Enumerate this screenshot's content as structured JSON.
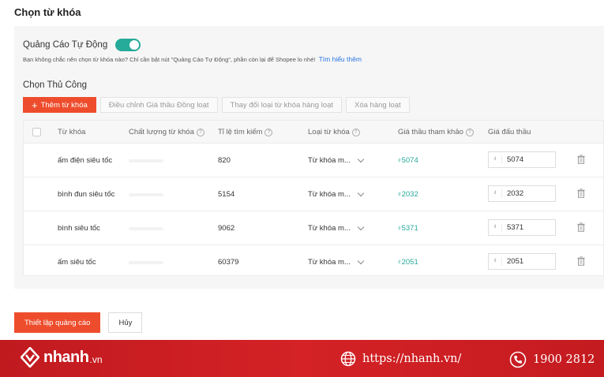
{
  "section_title": "Chọn từ khóa",
  "auto_ads": {
    "label": "Quảng Cáo Tự Động",
    "enabled": true,
    "description": "Bạn không chắc nên chọn từ khóa nào? Chỉ cần bật nút \"Quảng Cáo Tự Động\", phần còn lại để Shopee lo nhé!",
    "learn_more": "Tìm hiểu thêm"
  },
  "manual": {
    "title": "Chọn Thủ Công",
    "add_keyword": "Thêm từ khóa",
    "adjust_bid": "Điều chỉnh Giá thầu Đồng loạt",
    "change_type": "Thay đổi loại từ khóa hàng loạt",
    "delete_bulk": "Xóa hàng loạt"
  },
  "table": {
    "headers": {
      "keyword": "Từ khóa",
      "quality": "Chất lượng từ khóa",
      "search_rate": "Tỉ lệ tìm kiếm",
      "type": "Loại từ khóa",
      "ref_bid": "Giá thầu tham khảo",
      "bid": "Giá đấu thầu"
    },
    "currency": "₫",
    "rows": [
      {
        "keyword": "ấm điện siêu tốc",
        "quality": 0.68,
        "search_rate": "820",
        "type": "Từ khóa m...",
        "ref_bid": "5074",
        "bid": "5074"
      },
      {
        "keyword": "bình đun siêu tốc",
        "quality": 0.78,
        "search_rate": "5154",
        "type": "Từ khóa m...",
        "ref_bid": "2032",
        "bid": "2032"
      },
      {
        "keyword": "bình siêu tốc",
        "quality": 0.68,
        "search_rate": "9062",
        "type": "Từ khóa m...",
        "ref_bid": "5371",
        "bid": "5371"
      },
      {
        "keyword": "ấm siêu tốc",
        "quality": 0.88,
        "search_rate": "60379",
        "type": "Từ khóa m...",
        "ref_bid": "2051",
        "bid": "2051"
      }
    ]
  },
  "footer": {
    "setup_button": "Thiết lập quảng cáo",
    "cancel_button": "Hủy"
  },
  "banner": {
    "logo_text": "nhanh",
    "logo_suffix": ".vn",
    "website": "https://nhanh.vn/",
    "phone": "1900 2812"
  },
  "colors": {
    "accent": "#ee4d2d",
    "toggle": "#26aa99",
    "banner": "#d42226"
  }
}
